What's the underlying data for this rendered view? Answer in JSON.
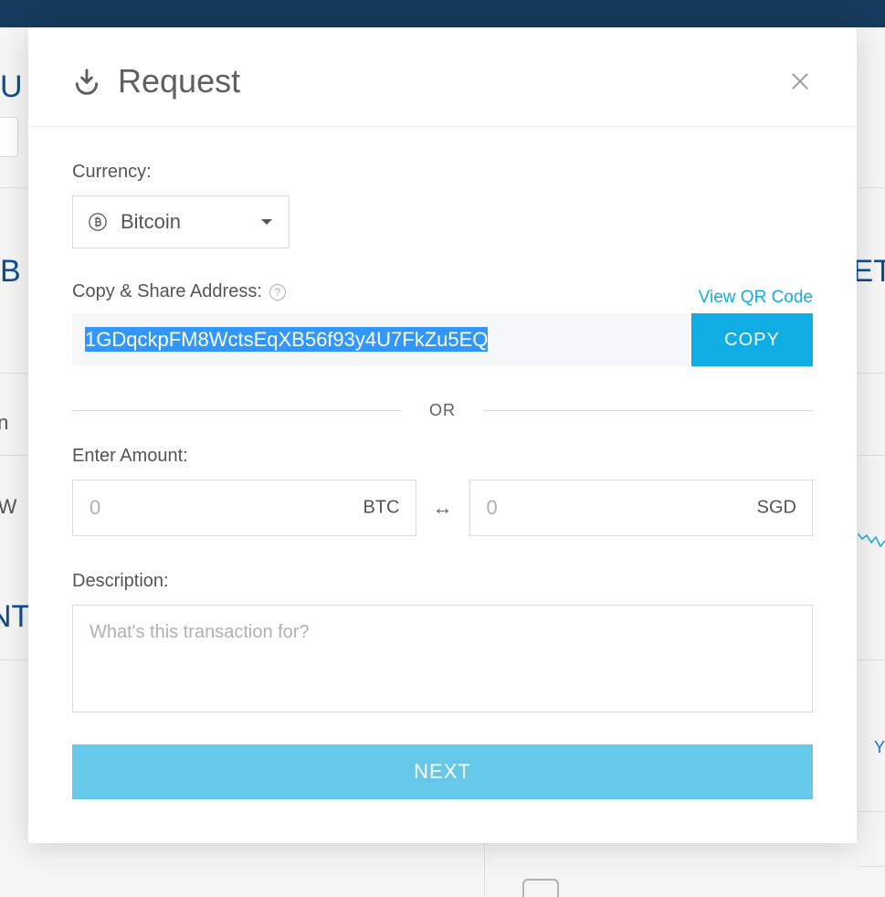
{
  "modal": {
    "title": "Request",
    "currency_label": "Currency:",
    "currency_selected": "Bitcoin",
    "address_label": "Copy & Share Address:",
    "view_qr": "View QR Code",
    "address": "1GDqckpFM8WctsEqXB56f93y4U7FkZu5EQ",
    "copy_btn": "COPY",
    "or_text": "OR",
    "amount_label": "Enter Amount:",
    "amount_btc_placeholder": "0",
    "amount_btc_suffix": "BTC",
    "amount_fiat_placeholder": "0",
    "amount_fiat_suffix": "SGD",
    "description_label": "Description:",
    "description_placeholder": "What's this transaction for?",
    "next_btn": "NEXT",
    "help_char": "?"
  },
  "swap_glyph": "↔",
  "bg": {
    "l1": "U",
    "l2": "B",
    "l3": "oin",
    "l4": "er W",
    "l5": "NT",
    "r1": "ET",
    "y": "Y"
  }
}
